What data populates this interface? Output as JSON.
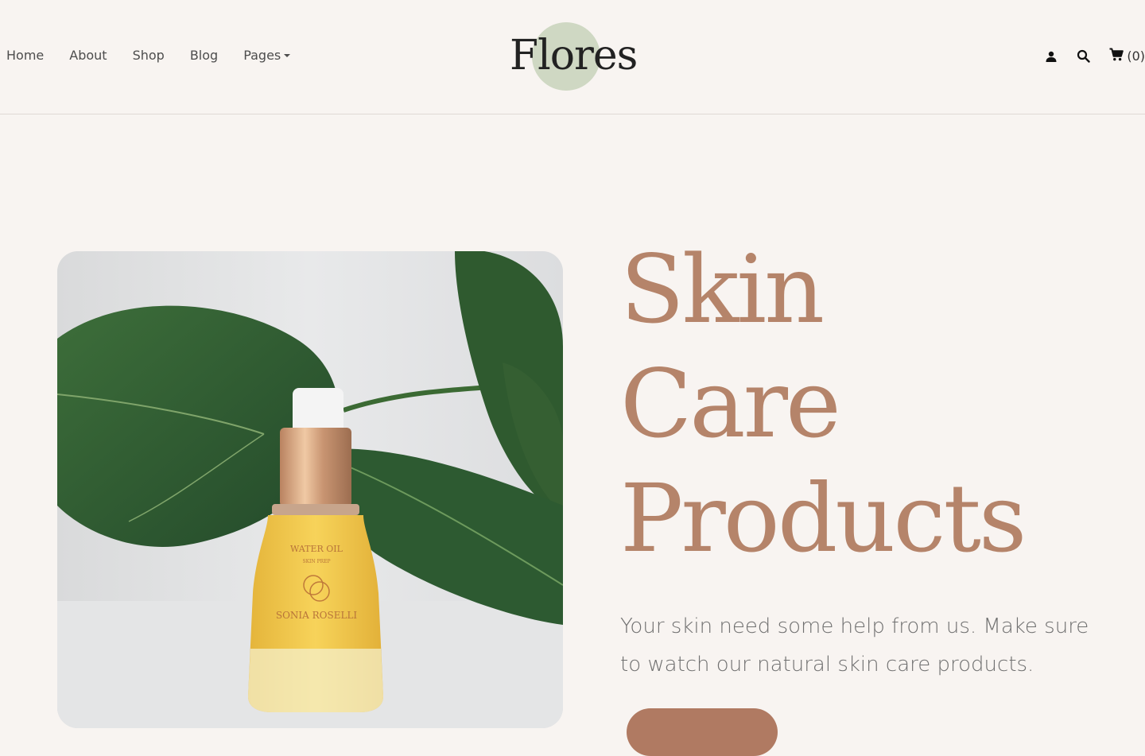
{
  "nav": {
    "items": [
      {
        "label": "Home"
      },
      {
        "label": "About"
      },
      {
        "label": "Shop"
      },
      {
        "label": "Blog"
      },
      {
        "label": "Pages"
      }
    ]
  },
  "logo": {
    "text": "Flores"
  },
  "header_icons": {
    "account": "user-icon",
    "search": "search-icon",
    "cart": "cart-icon",
    "cart_count": "(0)"
  },
  "hero": {
    "title_lines": [
      "Skin",
      "Care",
      "Products"
    ],
    "subtitle": "Your skin need some help from us. Make sure to watch our natural skin care products.",
    "button_label": ""
  },
  "colors": {
    "background": "#f8f4f1",
    "accent": "#b5846a",
    "logo_circle": "#cfd8c3"
  }
}
